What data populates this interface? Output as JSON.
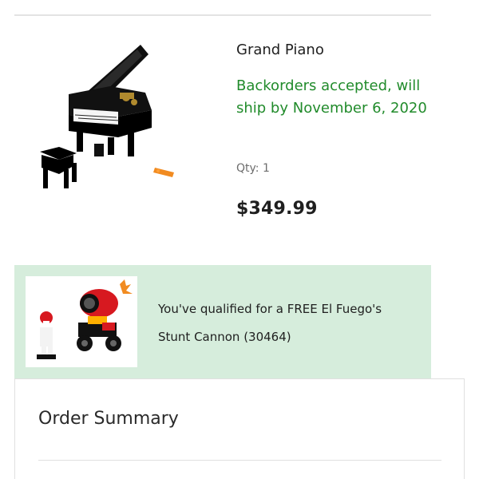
{
  "product": {
    "title": "Grand Piano",
    "availability": "Backorders accepted, will ship by November 6, 2020",
    "qty_text": "Qty: 1",
    "price": "$349.99",
    "image_icon": "grand-piano-set-image"
  },
  "promo": {
    "text": "You've qualified for a FREE El Fuego's Stunt Cannon (30464)",
    "image_icon": "stunt-cannon-set-image",
    "background_color": "#d6eddc"
  },
  "summary": {
    "title": "Order Summary"
  },
  "colors": {
    "availability": "#218b2b",
    "text": "#1f1f1f",
    "muted": "#6d6d6d"
  }
}
